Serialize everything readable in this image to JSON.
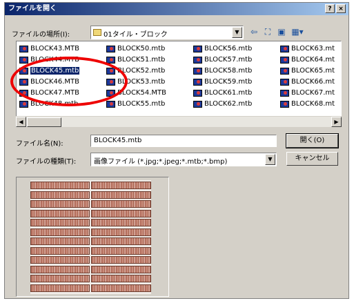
{
  "window": {
    "title": "ファイルを開く",
    "help_label": "?",
    "close_label": "×"
  },
  "location": {
    "label": "ファイルの場所(I):",
    "value": "01タイル・ブロック"
  },
  "toolbar_icons": [
    "back-arrow-icon",
    "up-folder-icon",
    "new-folder-icon",
    "view-menu-icon"
  ],
  "files": [
    [
      "BLOCK43.MTB",
      "BLOCK44.MTB",
      "BLOCK45.mtb",
      "BLOCK46.MTB",
      "BLOCK47.MTB",
      "BLOCK48.mtb"
    ],
    [
      "BLOCK50.mtb",
      "BLOCK51.mtb",
      "BLOCK52.mtb",
      "BLOCK53.mtb",
      "BLOCK54.MTB",
      "BLOCK55.mtb"
    ],
    [
      "BLOCK56.mtb",
      "BLOCK57.mtb",
      "BLOCK58.mtb",
      "BLOCK59.mtb",
      "BLOCK61.mtb",
      "BLOCK62.mtb"
    ],
    [
      "BLOCK63.mt",
      "BLOCK64.mt",
      "BLOCK65.mt",
      "BLOCK66.mt",
      "BLOCK67.mt",
      "BLOCK68.mt"
    ]
  ],
  "selected_file": "BLOCK45.mtb",
  "filename": {
    "label": "ファイル名(N):",
    "value": "BLOCK45.mtb"
  },
  "filetype": {
    "label": "ファイルの種類(T):",
    "value": "画像ファイル (*.jpg;*.jpeg;*.mtb;*.bmp)"
  },
  "buttons": {
    "open": "開く(O)",
    "cancel": "キャンセル"
  },
  "colors": {
    "title_bar_start": "#0a246a",
    "title_bar_end": "#a6caf0",
    "highlight": "#e00000",
    "selection": "#0a246a"
  }
}
